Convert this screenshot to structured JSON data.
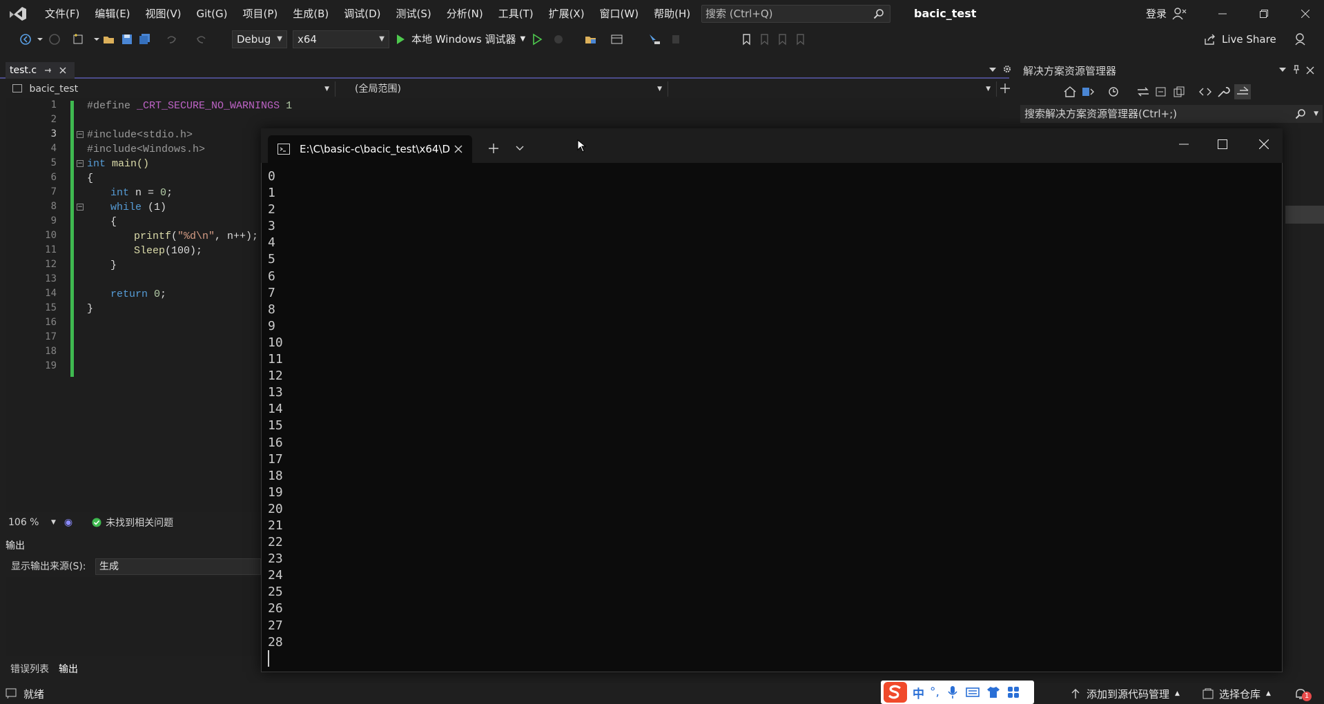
{
  "titlebar": {
    "menu": [
      "文件(F)",
      "编辑(E)",
      "视图(V)",
      "Git(G)",
      "项目(P)",
      "生成(B)",
      "调试(D)",
      "测试(S)",
      "分析(N)",
      "工具(T)",
      "扩展(X)",
      "窗口(W)",
      "帮助(H)"
    ],
    "search_placeholder": "搜索 (Ctrl+Q)",
    "solution_name": "bacic_test",
    "login_label": "登录"
  },
  "toolbar": {
    "configuration": "Debug",
    "platform": "x64",
    "run_label": "本地 Windows 调试器",
    "live_share_label": "Live Share"
  },
  "editor": {
    "tab_name": "test.c",
    "project_combo": "bacic_test",
    "scope_combo": "(全局范围)",
    "zoom": "106 %",
    "issues_text": "未找到相关问题",
    "active_line": 3,
    "line_numbers": [
      "1",
      "2",
      "3",
      "4",
      "5",
      "6",
      "7",
      "8",
      "9",
      "10",
      "11",
      "12",
      "13",
      "14",
      "15",
      "16",
      "17",
      "18",
      "19"
    ],
    "code": {
      "l1_directive": "#define",
      "l1_macro": "_CRT_SECURE_NO_WARNINGS",
      "l1_value": "1",
      "l3": "#include<stdio.h>",
      "l4": "#include<Windows.h>",
      "l5_type": "int",
      "l5_rest": "main()",
      "l6": "{",
      "l7_type": "int",
      "l7_rest": "n = ",
      "l7_value": "0",
      "l7_end": ";",
      "l8_kw": "while",
      "l8_rest": "(1)",
      "l9": "{",
      "l10_fn": "printf",
      "l10_open": "(",
      "l10_str": "\"%d\\n\"",
      "l10_rest": ", n++);",
      "l11_fn": "Sleep",
      "l11_rest": "(100);",
      "l12": "}",
      "l14_kw": "return",
      "l14_value": "0",
      "l14_end": ";",
      "l15": "}"
    }
  },
  "output_panel": {
    "title": "输出",
    "source_label": "显示输出来源(S):",
    "source_value": "生成",
    "tabs": [
      "错误列表",
      "输出"
    ]
  },
  "solution_explorer": {
    "title": "解决方案资源管理器",
    "search_placeholder": "搜索解决方案资源管理器(Ctrl+;)"
  },
  "console": {
    "tab_title": "E:\\C\\basic-c\\bacic_test\\x64\\D",
    "output_lines": [
      "0",
      "1",
      "2",
      "3",
      "4",
      "5",
      "6",
      "7",
      "8",
      "9",
      "10",
      "11",
      "12",
      "13",
      "14",
      "15",
      "16",
      "17",
      "18",
      "19",
      "20",
      "21",
      "22",
      "23",
      "24",
      "25",
      "26",
      "27",
      "28"
    ]
  },
  "statusbar": {
    "ready": "就绪",
    "add_source_control": "添加到源代码管理",
    "select_repo": "选择仓库",
    "notification_count": "1",
    "ime_mode": "中"
  },
  "colors": {
    "accent_green": "#3fb950",
    "run_green": "#4ec94e",
    "console_bg": "#0c0c0c",
    "ide_bg": "#1f1f1f"
  }
}
